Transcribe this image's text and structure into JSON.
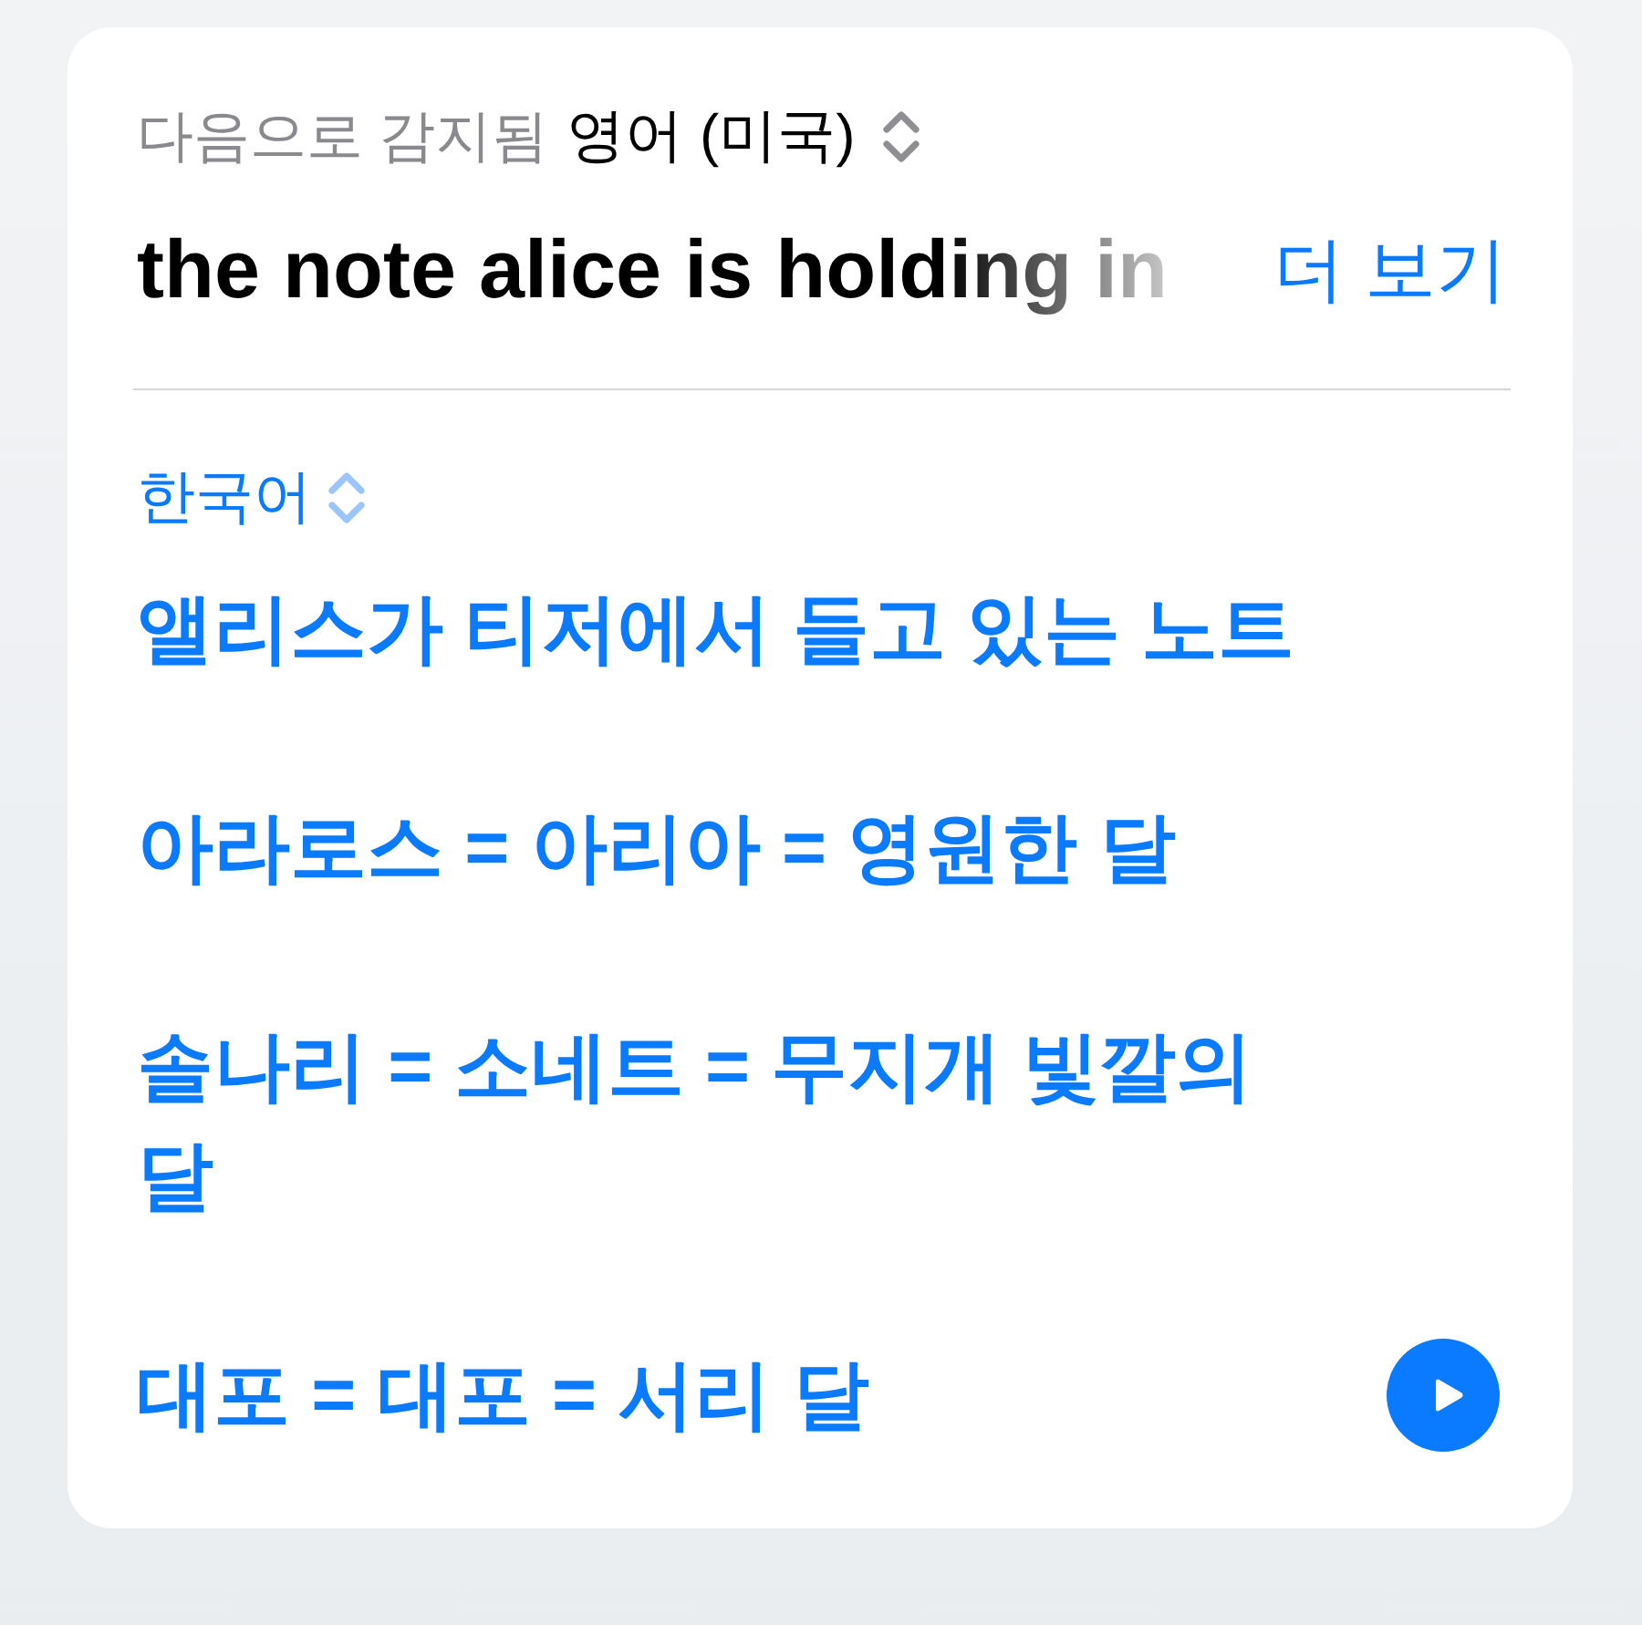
{
  "source": {
    "detected_label": "다음으로 감지됨",
    "language": "영어 (미국)",
    "text": "the note alice is holding in",
    "more_link": "더 보기"
  },
  "target": {
    "language": "한국어",
    "paragraphs": [
      "앨리스가 티저에서 들고 있는 노트",
      "아라로스 = 아리아 = 영원한 달",
      "솔나리 = 소네트 = 무지개 빛깔의 달",
      "대포 = 대포 = 서리 달"
    ]
  }
}
